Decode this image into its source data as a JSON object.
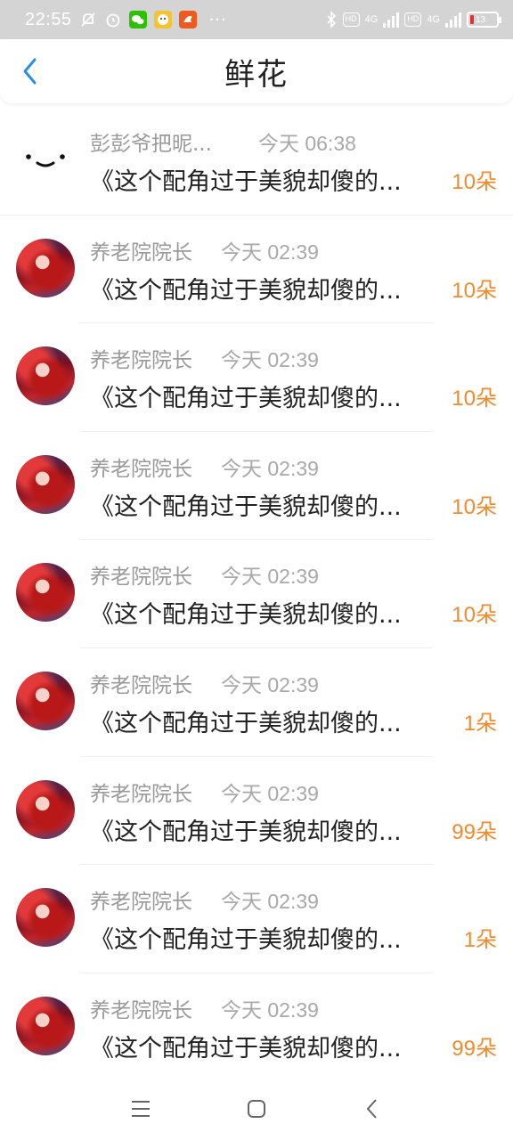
{
  "status_bar": {
    "time": "22:55",
    "network_1": "4G",
    "network_2": "4G",
    "hd_1": "HD",
    "hd_2": "HD",
    "battery_level": "13",
    "more": "···"
  },
  "header": {
    "title": "鲜花",
    "back_icon": "chevron-left-icon"
  },
  "colors": {
    "accent": "#2b8fe0",
    "count": "#f08a2e",
    "meta": "#9a9a9a"
  },
  "list": {
    "items": [
      {
        "name": "彭彭爷把昵...",
        "time": "今天 06:38",
        "message": "《这个配角过于美貌却傻的...",
        "count": "10朵",
        "avatar": "face"
      },
      {
        "name": "养老院院长",
        "time": "今天 02:39",
        "message": "《这个配角过于美貌却傻的...",
        "count": "10朵",
        "avatar": "art"
      },
      {
        "name": "养老院院长",
        "time": "今天 02:39",
        "message": "《这个配角过于美貌却傻的...",
        "count": "10朵",
        "avatar": "art"
      },
      {
        "name": "养老院院长",
        "time": "今天 02:39",
        "message": "《这个配角过于美貌却傻的...",
        "count": "10朵",
        "avatar": "art"
      },
      {
        "name": "养老院院长",
        "time": "今天 02:39",
        "message": "《这个配角过于美貌却傻的...",
        "count": "10朵",
        "avatar": "art"
      },
      {
        "name": "养老院院长",
        "time": "今天 02:39",
        "message": "《这个配角过于美貌却傻的...",
        "count": "1朵",
        "avatar": "art"
      },
      {
        "name": "养老院院长",
        "time": "今天 02:39",
        "message": "《这个配角过于美貌却傻的...",
        "count": "99朵",
        "avatar": "art"
      },
      {
        "name": "养老院院长",
        "time": "今天 02:39",
        "message": "《这个配角过于美貌却傻的...",
        "count": "1朵",
        "avatar": "art"
      },
      {
        "name": "养老院院长",
        "time": "今天 02:39",
        "message": "《这个配角过于美貌却傻的...",
        "count": "99朵",
        "avatar": "art"
      }
    ]
  },
  "navbar": {
    "menu_icon": "menu-icon",
    "home_icon": "home-icon",
    "back_icon": "back-icon"
  }
}
